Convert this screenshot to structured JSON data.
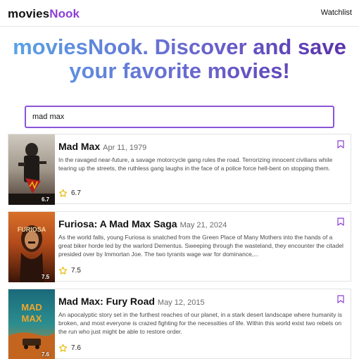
{
  "nav": {
    "logo_part1": "movies",
    "logo_part2": "Nook",
    "watchlist_label": "Watchlist"
  },
  "hero": {
    "headline": "moviesNook. Discover and save your favorite movies!"
  },
  "search": {
    "value": "mad max"
  },
  "colors": {
    "accent": "#8b3fd6",
    "gradient_start": "#58a6e8",
    "gradient_end": "#5a2fa8",
    "star": "#e6b800"
  },
  "movies": [
    {
      "title": "Mad Max",
      "date": "Apr 11, 1979",
      "overview": "In the ravaged near-future, a savage motorcycle gang rules the road. Terrorizing innocent civilians while tearing up the streets, the ruthless gang laughs in the face of a police force hell-bent on stopping them.",
      "rating": "6.7",
      "poster_rating": "6.7"
    },
    {
      "title": "Furiosa: A Mad Max Saga",
      "date": "May 21, 2024",
      "overview": "As the world falls, young Furiosa is snatched from the Green Place of Many Mothers into the hands of a great biker horde led by the warlord Dementus. Sweeping through the wasteland, they encounter the citadel presided over by Immortan Joe. The two tyrants wage war for dominance,...",
      "rating": "7.5",
      "poster_rating": "7.5"
    },
    {
      "title": "Mad Max: Fury Road",
      "date": "May 12, 2015",
      "overview": "An apocalyptic story set in the furthest reaches of our planet, in a stark desert landscape where humanity is broken, and most everyone is crazed fighting for the necessities of life. Within this world exist two rebels on the run who just might be able to restore order.",
      "rating": "7.6",
      "poster_rating": "7.6"
    }
  ]
}
